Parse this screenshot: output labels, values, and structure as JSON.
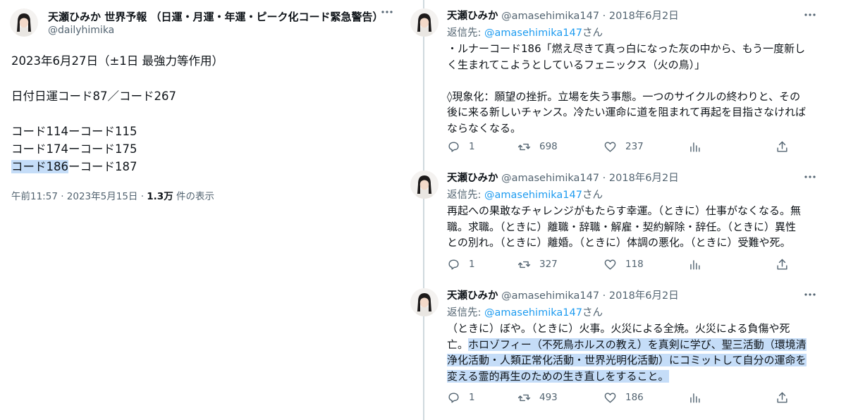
{
  "left_tweet": {
    "author_name": "天瀬ひみか 世界予報 （日運・月運・年運・ピーク化コード緊急警告）",
    "handle": "@dailyhimika",
    "lines": [
      "2023年6月27日（±1日 最強力等作用）",
      "",
      "日付日運コード87／コード267",
      "",
      "コード114ーコード115",
      "コード174ーコード175"
    ],
    "last_line_highlighted": "コード186",
    "last_line_rest": "ーコード187",
    "time": "午前11:57 · 2023年5月15日 · ",
    "views_count": "1.3万",
    "views_label": " 件の表示"
  },
  "thread": [
    {
      "name": "天瀬ひみか",
      "handle": "@amasehimika147",
      "date": " · 2018年6月2日",
      "reply_prefix": "返信先: ",
      "reply_to": "@amasehimika147",
      "reply_suffix": "さん",
      "lines": [
        "・ルナーコード186「燃え尽きて真っ白になった灰の中から、もう一度新し",
        "く生まれてこようとしているフェニックス（火の鳥）」",
        "",
        "◊現象化：願望の挫折。立場を失う事態。一つのサイクルの終わりと、その",
        "後に来る新しいチャンス。冷たい運命に道を阻まれて再起を目指さなければ",
        "ならなくなる。"
      ],
      "replies": "1",
      "retweets": "698",
      "likes": "237"
    },
    {
      "name": "天瀬ひみか",
      "handle": "@amasehimika147",
      "date": " · 2018年6月2日",
      "reply_prefix": "返信先: ",
      "reply_to": "@amasehimika147",
      "reply_suffix": "さん",
      "lines": [
        "再起への果敢なチャレンジがもたらす幸運。（ときに）仕事がなくなる。無",
        "職。求職。（ときに）離職・辞職・解雇・契約解除・辞任。（ときに）異性",
        "との別れ。（ときに）離婚。（ときに）体調の悪化。（ときに）受難や死。"
      ],
      "replies": "1",
      "retweets": "327",
      "likes": "118"
    },
    {
      "name": "天瀬ひみか",
      "handle": "@amasehimika147",
      "date": " · 2018年6月2日",
      "reply_prefix": "返信先: ",
      "reply_to": "@amasehimika147",
      "reply_suffix": "さん",
      "line1": "（ときに）ぼや。（ときに）火事。火災による全焼。火災による負傷や死",
      "line2_plain": "亡。",
      "line2_hl": "ホロゾフィー（不死鳥ホルスの教え）を真剣に学び、聖三活動（環境清",
      "line3_hl": "浄化活動・人類正常化活動・世界光明化活動）にコミットして自分の運命を",
      "line4_hl": "変える霊的再生のための生き直しをすること。",
      "replies": "1",
      "retweets": "493",
      "likes": "186"
    }
  ]
}
